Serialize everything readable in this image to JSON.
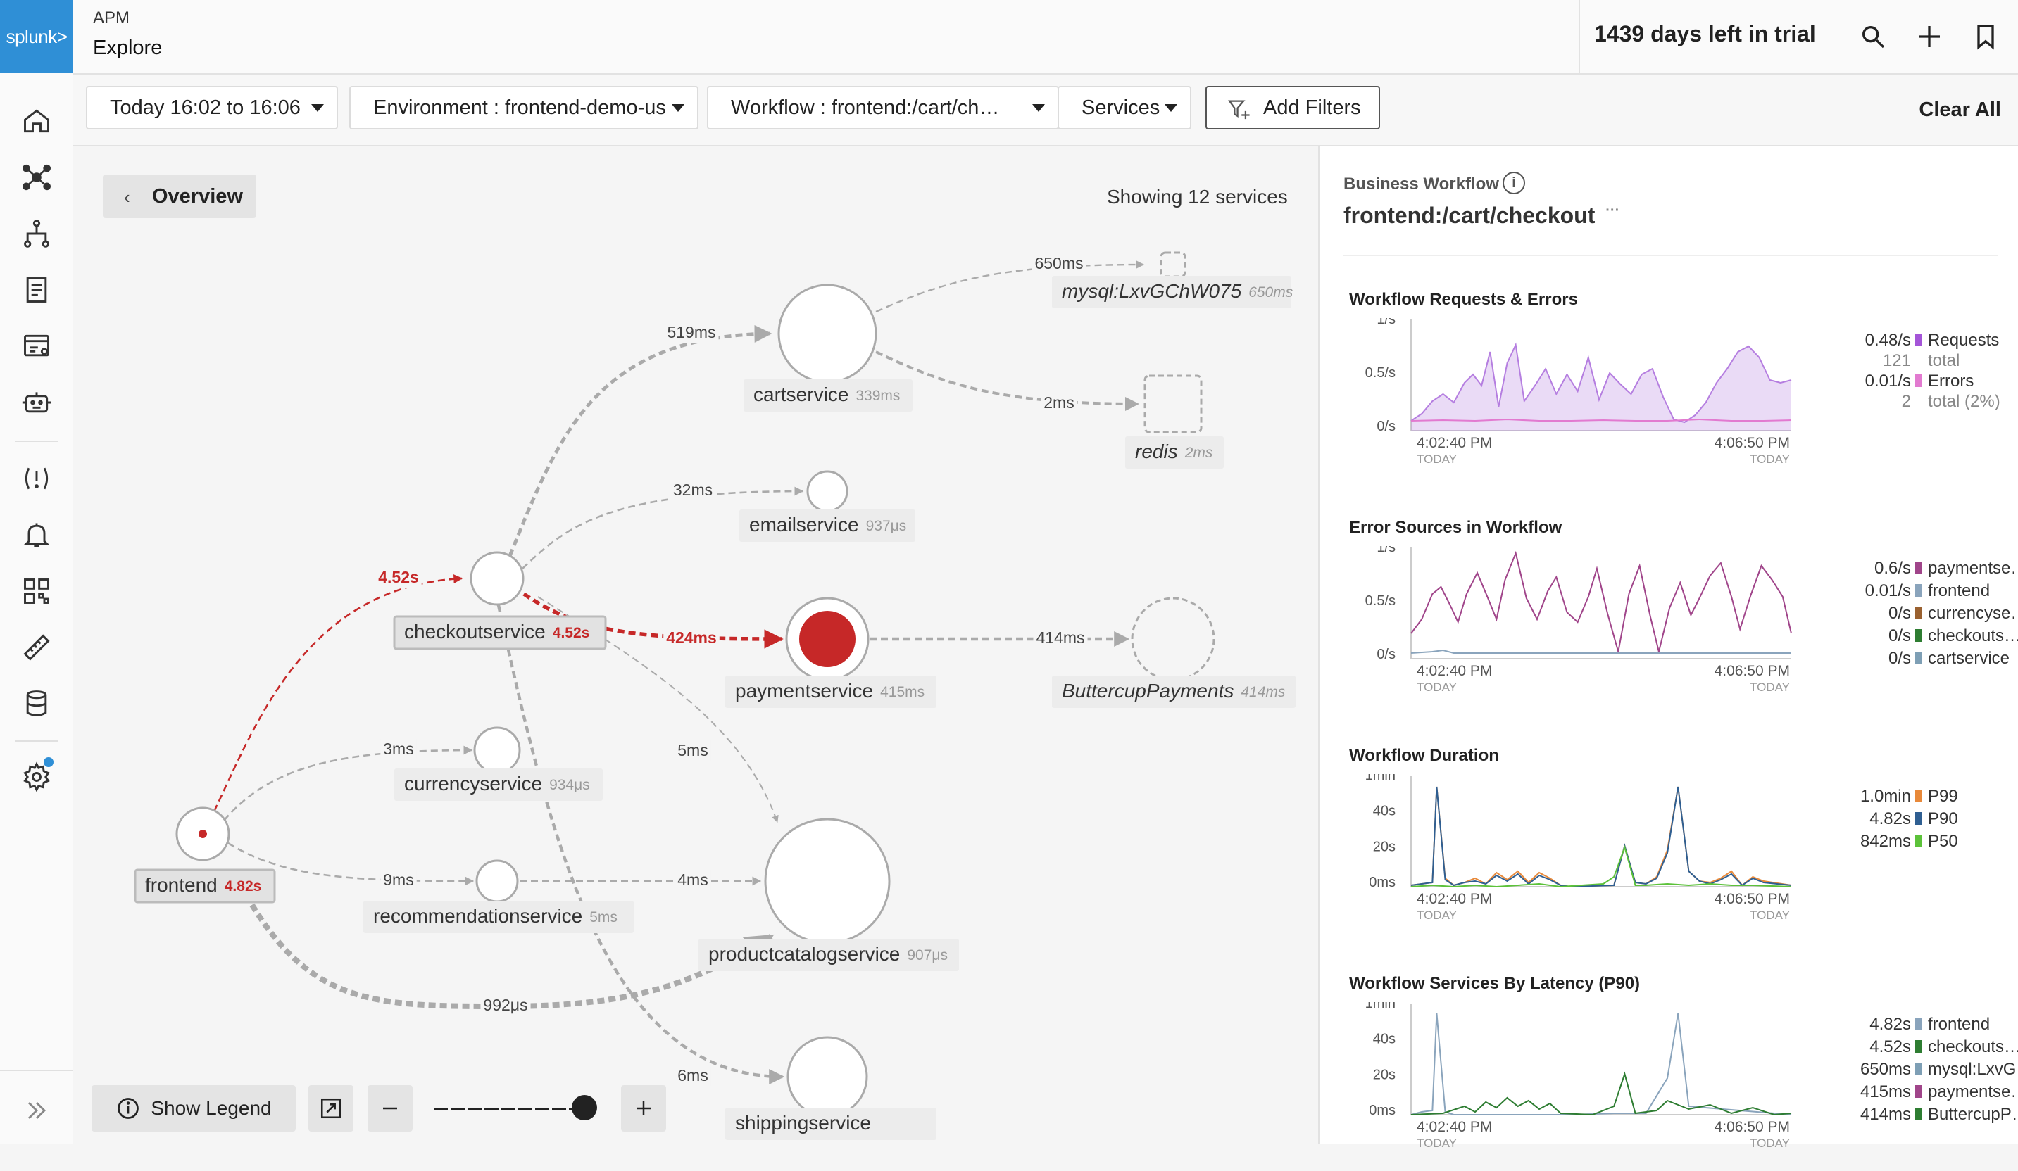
{
  "app": {
    "logo": "splunk>"
  },
  "header": {
    "section": "APM",
    "title": "Explore",
    "trial": "1439 days left in trial"
  },
  "nav_icons": [
    "home-icon",
    "service-map-icon",
    "hierarchy-icon",
    "document-icon",
    "browser-icon",
    "robot-icon",
    "alert-exclamation-icon",
    "bell-icon",
    "dashboard-grid-icon",
    "ruler-icon",
    "database-icon",
    "settings-gear-icon",
    "expand-chevrons-icon"
  ],
  "filters": {
    "time": "Today 16:02 to 16:06",
    "environment": "Environment : frontend-demo-us",
    "workflow": "Workflow : frontend:/cart/ch…",
    "services": "Services",
    "add_filters": "Add Filters",
    "clear_all": "Clear All"
  },
  "map": {
    "overview": "Overview",
    "showing": "Showing 12 services",
    "nodes": [
      {
        "name": "frontend",
        "latency": "4.82s",
        "latency_color": "#c62828",
        "style": "error-origin"
      },
      {
        "name": "checkoutservice",
        "latency": "4.52s",
        "latency_color": "#c62828",
        "style": "normal"
      },
      {
        "name": "cartservice",
        "latency": "339ms",
        "latency_color": "#999",
        "style": "normal"
      },
      {
        "name": "emailservice",
        "latency": "937μs",
        "latency_color": "#999",
        "style": "normal"
      },
      {
        "name": "paymentservice",
        "latency": "415ms",
        "latency_color": "#999",
        "style": "error"
      },
      {
        "name": "currencyservice",
        "latency": "934μs",
        "latency_color": "#999",
        "style": "normal"
      },
      {
        "name": "recommendationservice",
        "latency": "5ms",
        "latency_color": "#999",
        "style": "normal"
      },
      {
        "name": "productcatalogservice",
        "latency": "907μs",
        "latency_color": "#999",
        "style": "normal"
      },
      {
        "name": "shippingservice",
        "latency": "",
        "latency_color": "#999",
        "style": "normal"
      },
      {
        "name": "mysql:LxvGChW075",
        "latency": "650ms",
        "latency_color": "#999",
        "style": "inferred-db"
      },
      {
        "name": "redis",
        "latency": "2ms",
        "latency_color": "#999",
        "style": "inferred-db"
      },
      {
        "name": "ButtercupPayments",
        "latency": "414ms",
        "latency_color": "#999",
        "style": "inferred-service"
      }
    ],
    "edges": [
      {
        "from": "frontend",
        "to": "checkoutservice",
        "label": "4.52s",
        "error": true
      },
      {
        "from": "checkoutservice",
        "to": "cartservice",
        "label": "519ms",
        "error": false
      },
      {
        "from": "cartservice",
        "to": "mysql:LxvGChW075",
        "label": "650ms",
        "error": false
      },
      {
        "from": "cartservice",
        "to": "redis",
        "label": "2ms",
        "error": false
      },
      {
        "from": "checkoutservice",
        "to": "emailservice",
        "label": "32ms",
        "error": false
      },
      {
        "from": "checkoutservice",
        "to": "paymentservice",
        "label": "424ms",
        "error": true
      },
      {
        "from": "paymentservice",
        "to": "ButtercupPayments",
        "label": "414ms",
        "error": false
      },
      {
        "from": "checkoutservice",
        "to": "productcatalogservice",
        "label": "5ms",
        "error": false
      },
      {
        "from": "frontend",
        "to": "currencyservice",
        "label": "3ms",
        "error": false
      },
      {
        "from": "frontend",
        "to": "recommendationservice",
        "label": "9ms",
        "error": false
      },
      {
        "from": "recommendationservice",
        "to": "productcatalogservice",
        "label": "4ms",
        "error": false
      },
      {
        "from": "frontend",
        "to": "productcatalogservice",
        "label": "992μs",
        "error": false
      },
      {
        "from": "checkoutservice",
        "to": "shippingservice",
        "label": "6ms",
        "error": false
      }
    ],
    "controls": {
      "show_legend": "Show Legend",
      "zoom_level": 1.0
    }
  },
  "panel": {
    "business_workflow_label": "Business Workflow",
    "info_glyph": "i",
    "workflow_name": "frontend:/cart/checkout",
    "workflow_more": "···",
    "time_start": "4:02:40 PM",
    "time_end": "4:06:50 PM",
    "time_sub": "TODAY",
    "sections": [
      {
        "title": "Workflow Requests & Errors",
        "y_ticks": [
          "1/s",
          "0.5/s",
          "0/s"
        ],
        "legend": [
          {
            "value": "0.48/s",
            "label": "Requests",
            "color": "#a455d8",
            "sub_value": "121",
            "sub_label": "total"
          },
          {
            "value": "0.01/s",
            "label": "Errors",
            "color": "#e27ad0",
            "sub_value": "2",
            "sub_label": "total (2%)"
          }
        ]
      },
      {
        "title": "Error Sources in Workflow",
        "y_ticks": [
          "1/s",
          "0.5/s",
          "0/s"
        ],
        "legend": [
          {
            "value": "0.6/s",
            "label": "paymentse…",
            "color": "#a0458a"
          },
          {
            "value": "0.01/s",
            "label": "frontend",
            "color": "#8aa4bc"
          },
          {
            "value": "0/s",
            "label": "currencyse…",
            "color": "#9a6130"
          },
          {
            "value": "0/s",
            "label": "checkouts…",
            "color": "#2e7d32"
          },
          {
            "value": "0/s",
            "label": "cartservice",
            "color": "#7e9fb5"
          }
        ]
      },
      {
        "title": "Workflow Duration",
        "y_ticks": [
          "1min",
          "40s",
          "20s",
          "0ms"
        ],
        "legend": [
          {
            "value": "1.0min",
            "label": "P99",
            "color": "#e8893a"
          },
          {
            "value": "4.82s",
            "label": "P90",
            "color": "#2f5f92"
          },
          {
            "value": "842ms",
            "label": "P50",
            "color": "#5cc23a"
          }
        ]
      },
      {
        "title": "Workflow Services By Latency (P90)",
        "y_ticks": [
          "1min",
          "40s",
          "20s",
          "0ms"
        ],
        "legend": [
          {
            "value": "4.82s",
            "label": "frontend",
            "color": "#8aa4bc"
          },
          {
            "value": "4.52s",
            "label": "checkouts…",
            "color": "#2e7d32"
          },
          {
            "value": "650ms",
            "label": "mysql:LxvG…",
            "color": "#7e9fb5"
          },
          {
            "value": "415ms",
            "label": "paymentse…",
            "color": "#a0458a"
          },
          {
            "value": "414ms",
            "label": "ButtercupP…",
            "color": "#2e7d32"
          }
        ]
      }
    ]
  }
}
